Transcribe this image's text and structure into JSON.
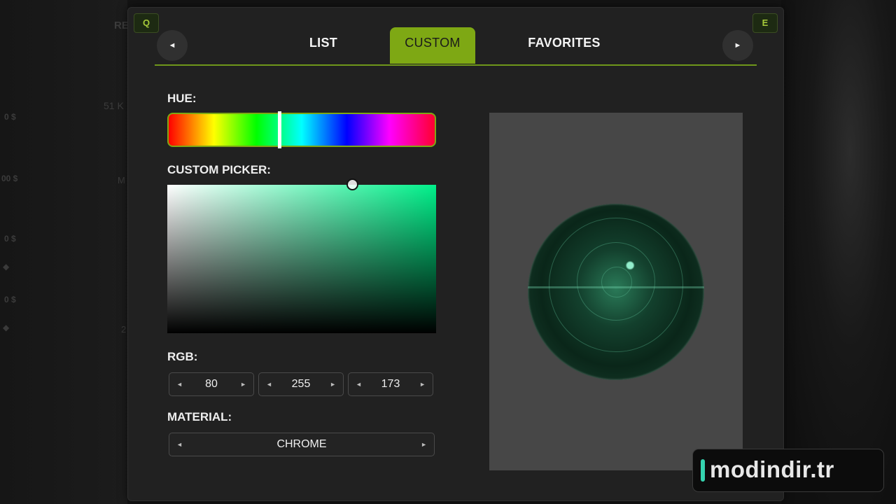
{
  "background": {
    "texts": [
      "RE",
      "51 K",
      "0 $",
      "00 $",
      "M",
      "0 $",
      "0 $",
      "2"
    ]
  },
  "hotkeys": {
    "left": "Q",
    "right": "E"
  },
  "tabs": [
    {
      "label": "LIST"
    },
    {
      "label": "CUSTOM",
      "active": true
    },
    {
      "label": "FAVORITES"
    }
  ],
  "nav": {
    "prev_icon": "◄",
    "next_icon": "►"
  },
  "hue": {
    "label": "HUE:",
    "value_fraction": 0.42
  },
  "picker": {
    "label": "CUSTOM PICKER:"
  },
  "rgb": {
    "label": "RGB:",
    "r": "80",
    "g": "255",
    "b": "173",
    "dec_icon": "◄",
    "inc_icon": "►"
  },
  "material": {
    "label": "MATERIAL:",
    "value": "CHROME"
  },
  "watermark": {
    "text": "modindir.tr"
  },
  "colors": {
    "accent": "#7ea814",
    "selected": "#50ffad"
  }
}
